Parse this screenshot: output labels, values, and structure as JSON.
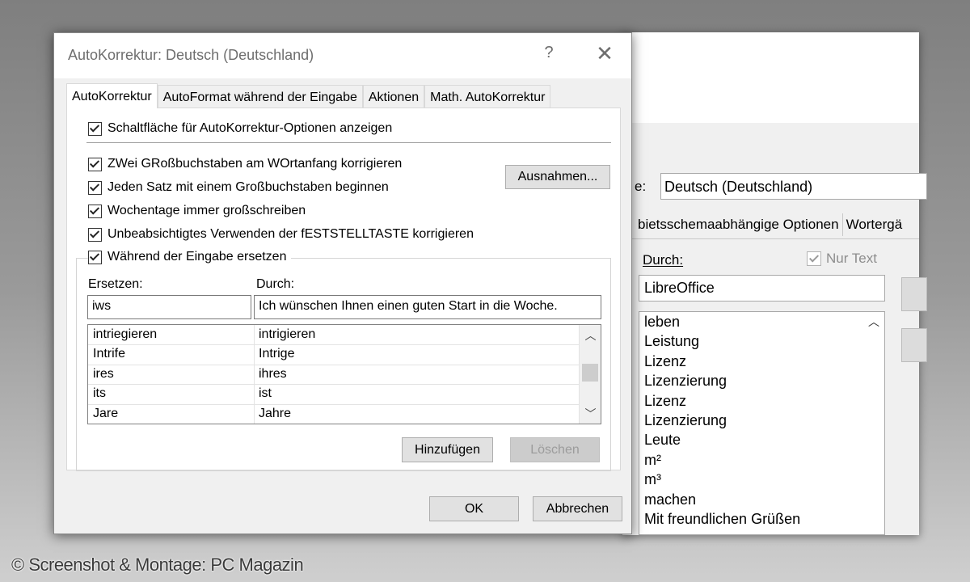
{
  "back_window": {
    "language_label_fragment": "e:",
    "language_value": "Deutsch (Deutschland)",
    "tabs": [
      "bietsschemaabhängige Optionen",
      "Wortergä"
    ],
    "durch_label": "Durch:",
    "nur_text_label": "Nur Text",
    "durch_value": "LibreOffice",
    "list_items": [
      "leben",
      "Leistung",
      "Lizenz",
      "Lizenzierung",
      "Lizenz",
      "Lizenzierung",
      "Leute",
      "m²",
      "m³",
      "machen",
      "Mit freundlichen Grüßen"
    ]
  },
  "dialog": {
    "title": "AutoKorrektur: Deutsch (Deutschland)",
    "help_glyph": "?",
    "close_glyph": "✕",
    "tabs": [
      "AutoKorrektur",
      "AutoFormat während der Eingabe",
      "Aktionen",
      "Math. AutoKorrektur"
    ],
    "show_options_label": "Schaltfläche für AutoKorrektur-Optionen anzeigen",
    "options": [
      "ZWei GRoßbuchstaben am WOrtanfang korrigieren",
      "Jeden Satz mit einem Großbuchstaben beginnen",
      "Wochentage immer großschreiben",
      "Unbeabsichtigtes Verwenden der fESTSTELLTASTE korrigieren"
    ],
    "exceptions_button": "Ausnahmen...",
    "replace_while_typing_label": "Während der Eingabe ersetzen",
    "replace_label": "Ersetzen:",
    "with_label": "Durch:",
    "replace_value": "iws",
    "with_value": "Ich wünschen Ihnen einen guten Start in die Woche.",
    "table_rows": [
      {
        "replace": "intriegieren",
        "with": "intrigieren"
      },
      {
        "replace": "Intrife",
        "with": "Intrige"
      },
      {
        "replace": "ires",
        "with": "ihres"
      },
      {
        "replace": "its",
        "with": "ist"
      },
      {
        "replace": "Jare",
        "with": "Jahre"
      }
    ],
    "add_button": "Hinzufügen",
    "delete_button": "Löschen",
    "ok_button": "OK",
    "cancel_button": "Abbrechen"
  },
  "watermark": "© Screenshot & Montage: PC Magazin"
}
